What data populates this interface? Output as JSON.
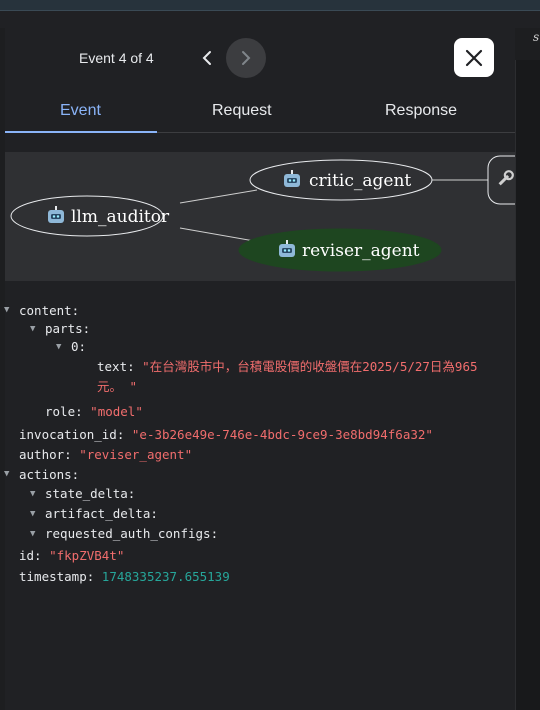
{
  "nav": {
    "title": "Event 4 of 4"
  },
  "tabs": [
    {
      "label": "Event"
    },
    {
      "label": "Request"
    },
    {
      "label": "Response"
    }
  ],
  "side_letter": "s",
  "graph": {
    "nodes": [
      {
        "label": "llm_auditor",
        "icon": "robot-icon"
      },
      {
        "label": "critic_agent",
        "icon": "robot-icon"
      },
      {
        "label": "reviser_agent",
        "icon": "robot-icon",
        "highlight_color": "#1e4620"
      },
      {
        "label": "",
        "icon": "wrench-icon"
      }
    ]
  },
  "event": {
    "content_key": "content:",
    "parts_key": "parts:",
    "index_key": "0:",
    "text_key": "text:",
    "text_value": "\"在台灣股市中，台積電股價的收盤價在2025/5/27日為965元。 \"",
    "role_key": "role:",
    "role_value": "\"model\"",
    "invocation_id_key": "invocation_id:",
    "invocation_id_value": "\"e-3b26e49e-746e-4bdc-9ce9-3e8bd94f6a32\"",
    "author_key": "author:",
    "author_value": "\"reviser_agent\"",
    "actions_key": "actions:",
    "state_delta_key": "state_delta:",
    "artifact_delta_key": "artifact_delta:",
    "requested_auth_configs_key": "requested_auth_configs:",
    "id_key": "id:",
    "id_value": "\"fkpZVB4t\"",
    "timestamp_key": "timestamp:",
    "timestamp_value": "1748335237.655139"
  }
}
